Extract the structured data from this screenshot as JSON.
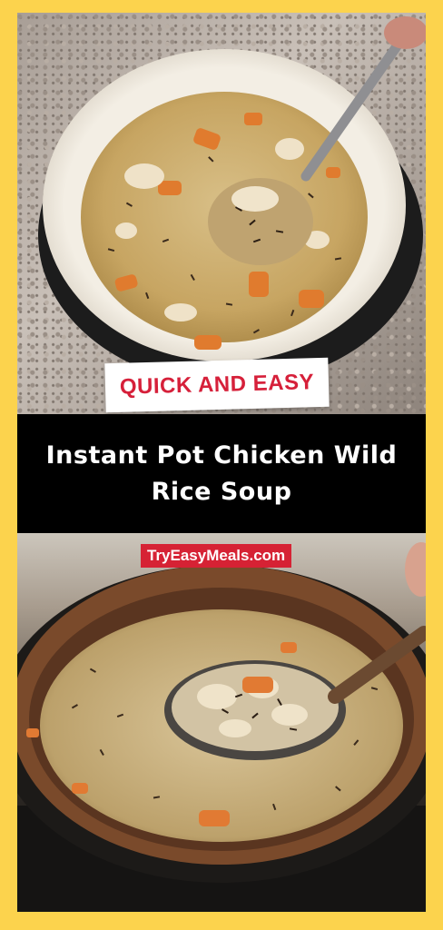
{
  "badge": {
    "label": "QUICK AND EASY"
  },
  "title": {
    "text": "Instant Pot Chicken Wild Rice Soup"
  },
  "site": {
    "label": "TryEasyMeals.com"
  },
  "colors": {
    "border": "#fcd34d",
    "badge_text": "#d6203a",
    "site_label_bg": "#d62234",
    "title_band": "#000000"
  }
}
